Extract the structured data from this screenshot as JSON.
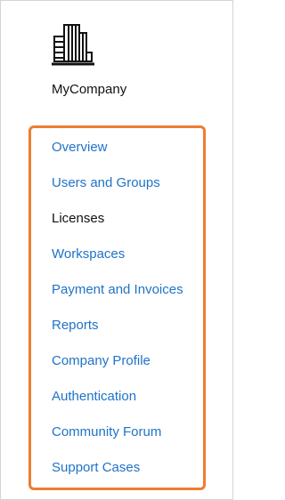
{
  "header": {
    "logo_icon": "building-icon",
    "company_name": "MyCompany"
  },
  "nav": {
    "highlight_color": "#ed7d31",
    "link_color": "#1f73c8",
    "items": [
      {
        "label": "Overview",
        "active": false
      },
      {
        "label": "Users and Groups",
        "active": false
      },
      {
        "label": "Licenses",
        "active": true
      },
      {
        "label": "Workspaces",
        "active": false
      },
      {
        "label": "Payment and Invoices",
        "active": false
      },
      {
        "label": "Reports",
        "active": false
      },
      {
        "label": "Company Profile",
        "active": false
      },
      {
        "label": "Authentication",
        "active": false
      },
      {
        "label": "Community Forum",
        "active": false
      },
      {
        "label": "Support Cases",
        "active": false
      }
    ]
  }
}
